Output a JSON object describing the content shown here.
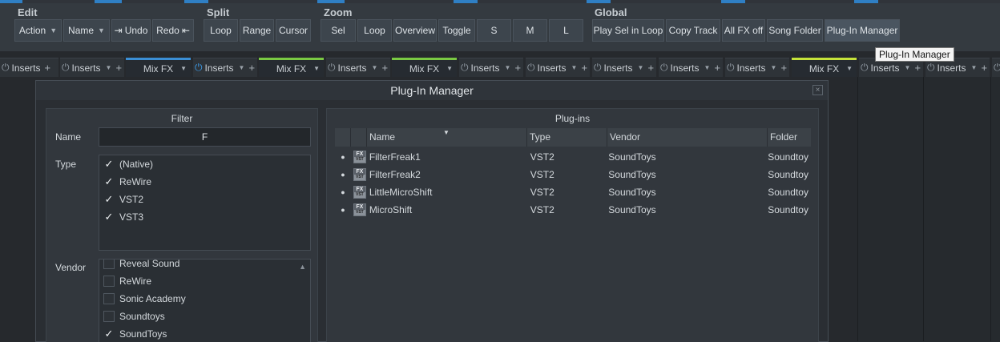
{
  "toolbar": {
    "groups": {
      "edit": "Edit",
      "split": "Split",
      "zoom": "Zoom",
      "global": "Global"
    },
    "edit_buttons": {
      "action": "Action",
      "name": "Name",
      "undo": "Undo",
      "redo": "Redo"
    },
    "split_buttons": {
      "loop": "Loop",
      "range": "Range",
      "cursor": "Cursor"
    },
    "zoom_buttons": {
      "sel": "Sel",
      "loop": "Loop",
      "overview": "Overview",
      "toggle": "Toggle",
      "s": "S",
      "m": "M",
      "l": "L"
    },
    "global_buttons": {
      "play_sel_in_loop": "Play Sel in Loop",
      "copy_track": "Copy Track",
      "all_fx_off": "All FX off",
      "song_folder": "Song Folder",
      "plugin_manager": "Plug-In Manager"
    }
  },
  "tooltip": "Plug-In Manager",
  "mixer": {
    "inserts_label": "Inserts",
    "mixfx_label": "Mix FX"
  },
  "window": {
    "title": "Plug-In Manager",
    "close": "×",
    "filter": {
      "title": "Filter",
      "name_label": "Name",
      "name_value": "F",
      "type_label": "Type",
      "types": [
        {
          "label": "(Native)",
          "checked": true
        },
        {
          "label": "ReWire",
          "checked": true
        },
        {
          "label": "VST2",
          "checked": true
        },
        {
          "label": "VST3",
          "checked": true
        }
      ],
      "vendor_label": "Vendor",
      "vendors": [
        {
          "label": "Reveal Sound",
          "checked": false
        },
        {
          "label": "ReWire",
          "checked": false
        },
        {
          "label": "Sonic Academy",
          "checked": false
        },
        {
          "label": "Soundtoys",
          "checked": false
        },
        {
          "label": "SoundToys",
          "checked": true
        }
      ]
    },
    "plugins": {
      "title": "Plug-ins",
      "columns": {
        "name": "Name",
        "type": "Type",
        "vendor": "Vendor",
        "folder": "Folder"
      },
      "rows": [
        {
          "name": "FilterFreak1",
          "type": "VST2",
          "vendor": "SoundToys",
          "folder": "Soundtoy"
        },
        {
          "name": "FilterFreak2",
          "type": "VST2",
          "vendor": "SoundToys",
          "folder": "Soundtoy"
        },
        {
          "name": "LittleMicroShift",
          "type": "VST2",
          "vendor": "SoundToys",
          "folder": "Soundtoy"
        },
        {
          "name": "MicroShift",
          "type": "VST2",
          "vendor": "SoundToys",
          "folder": "Soundtoy"
        }
      ]
    }
  }
}
